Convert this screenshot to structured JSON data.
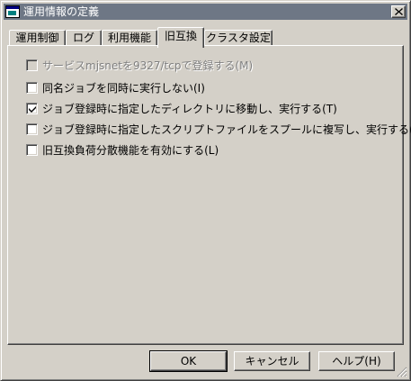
{
  "window": {
    "title": "運用情報の定義"
  },
  "tabs": [
    {
      "label": "運用制御",
      "active": false
    },
    {
      "label": "ログ",
      "active": false
    },
    {
      "label": "利用機能",
      "active": false
    },
    {
      "label": "旧互換",
      "active": true
    },
    {
      "label": "クラスタ設定",
      "active": false
    }
  ],
  "options": [
    {
      "label": "サービスmjsnetを9327/tcpで登録する(M)",
      "checked": false,
      "enabled": false
    },
    {
      "label": "同名ジョブを同時に実行しない(I)",
      "checked": false,
      "enabled": true
    },
    {
      "label": "ジョブ登録時に指定したディレクトリに移動し、実行する(T)",
      "checked": true,
      "enabled": true
    },
    {
      "label": "ジョブ登録時に指定したスクリプトファイルをスプールに複写し、実行する(S)",
      "checked": false,
      "enabled": true
    },
    {
      "label": "旧互換負荷分散機能を有効にする(L)",
      "checked": false,
      "enabled": true
    }
  ],
  "buttons": {
    "ok": "OK",
    "cancel": "キャンセル",
    "help": "ヘルプ(H)"
  },
  "icons": {
    "app": "window-app-icon",
    "close": "close-icon",
    "check": "check-icon",
    "grip": "resize-grip-icon"
  }
}
